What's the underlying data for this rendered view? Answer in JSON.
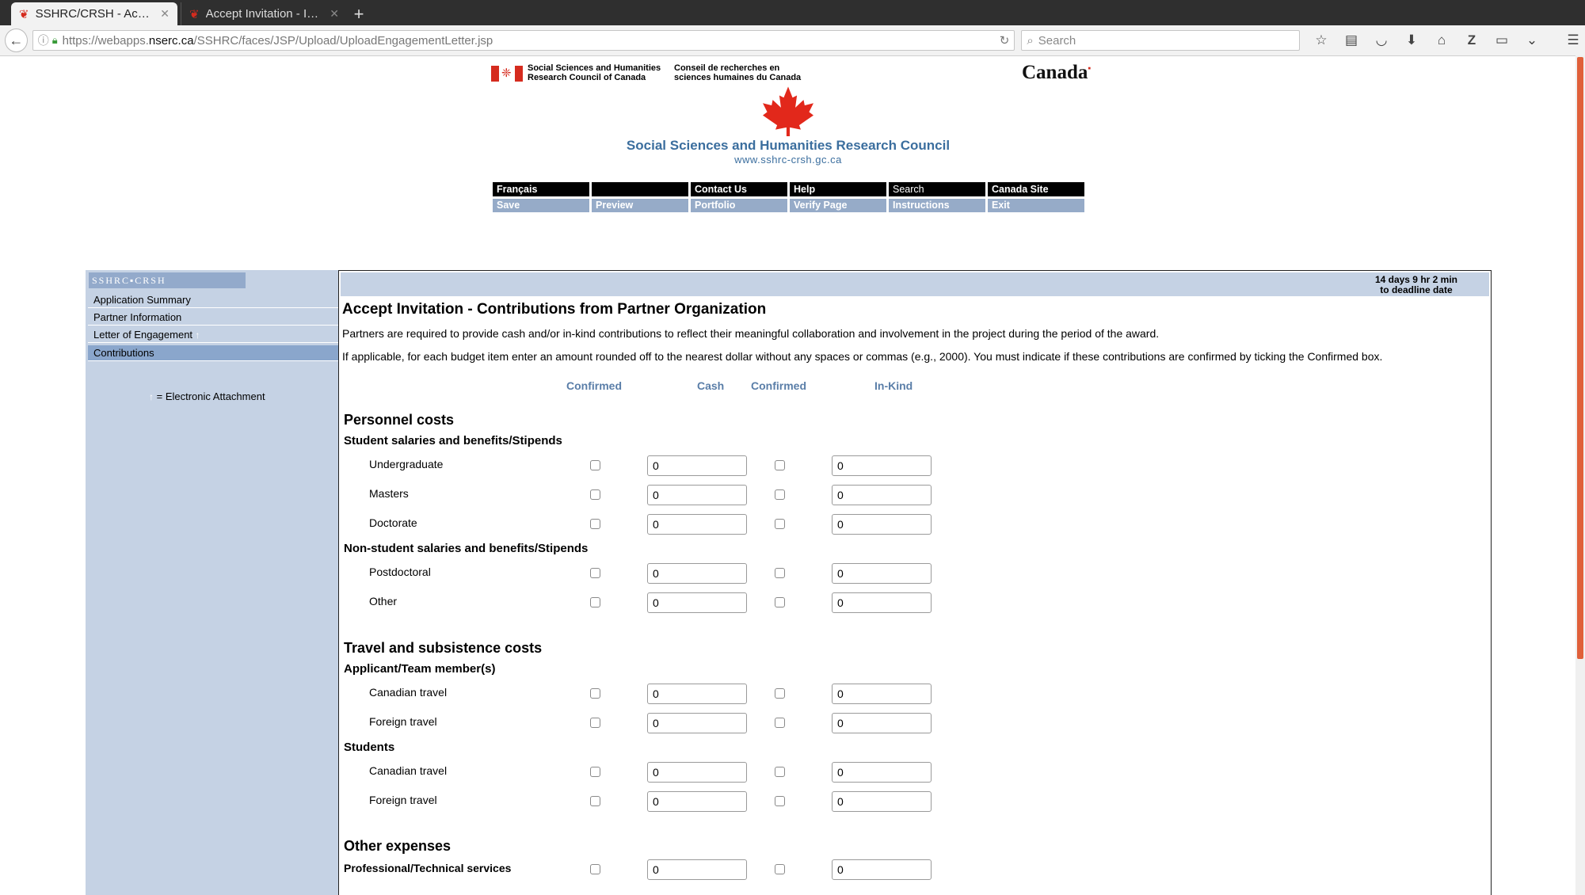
{
  "browser": {
    "tabs": [
      {
        "label": "SSHRC/CRSH - Acce…",
        "active": true
      },
      {
        "label": "Accept Invitation - I…",
        "active": false
      }
    ],
    "url_prefix": "https://webapps.",
    "url_domain": "nserc.ca",
    "url_path": "/SSHRC/faces/JSP/Upload/UploadEngagementLetter.jsp",
    "search_placeholder": "Search"
  },
  "header": {
    "fip_en": "Social Sciences and Humanities\nResearch Council of Canada",
    "fip_fr": "Conseil de recherches en\nsciences humaines du Canada",
    "wordmark": "Canada",
    "council_title": "Social Sciences and Humanities Research Council",
    "council_url": "www.sshrc-crsh.gc.ca",
    "menu_top": [
      "Français",
      "",
      "Contact Us",
      "Help",
      "Search",
      "Canada Site"
    ],
    "menu_bottom": [
      "Save",
      "Preview",
      "Portfolio",
      "Verify Page",
      "Instructions",
      "Exit"
    ]
  },
  "sidebar": {
    "logo": "SSHRC▪CRSH",
    "items": [
      {
        "label": "Application Summary",
        "selected": false
      },
      {
        "label": "Partner Information",
        "selected": false
      },
      {
        "label": "Letter of Engagement",
        "selected": false
      },
      {
        "label": "Contributions",
        "selected": true
      }
    ],
    "legend": "= Electronic Attachment"
  },
  "main": {
    "deadline_line1": "14 days 9 hr 2 min",
    "deadline_line2": "to deadline date",
    "title": "Accept Invitation - Contributions from Partner Organization",
    "para1": "Partners are required to provide cash and/or in-kind contributions to reflect their meaningful collaboration and involvement in the project during the period of the award.",
    "para2": "If applicable, for each budget item enter an amount rounded off to the nearest dollar without any spaces or commas (e.g., 2000). You must indicate if these contributions are confirmed by ticking the Confirmed box.",
    "col_confirmed": "Confirmed",
    "col_cash": "Cash",
    "col_confirmed2": "Confirmed",
    "col_inkind": "In-Kind",
    "sections": {
      "personnel": "Personnel costs",
      "student_salaries": "Student salaries and benefits/Stipends",
      "nonstudent_salaries": "Non-student salaries and benefits/Stipends",
      "travel": "Travel and subsistence costs",
      "applicant_team": "Applicant/Team member(s)",
      "students": "Students",
      "other": "Other expenses"
    },
    "rows": [
      {
        "label": "Undergraduate",
        "cash": "0",
        "inkind": "0"
      },
      {
        "label": "Masters",
        "cash": "0",
        "inkind": "0"
      },
      {
        "label": "Doctorate",
        "cash": "0",
        "inkind": "0"
      },
      {
        "label": "Postdoctoral",
        "cash": "0",
        "inkind": "0"
      },
      {
        "label": "Other",
        "cash": "0",
        "inkind": "0"
      },
      {
        "label": "Canadian travel",
        "cash": "0",
        "inkind": "0"
      },
      {
        "label": "Foreign travel",
        "cash": "0",
        "inkind": "0"
      },
      {
        "label": "Canadian travel",
        "cash": "0",
        "inkind": "0"
      },
      {
        "label": "Foreign travel",
        "cash": "0",
        "inkind": "0"
      },
      {
        "label": "Professional/Technical services",
        "cash": "0",
        "inkind": "0"
      }
    ]
  }
}
